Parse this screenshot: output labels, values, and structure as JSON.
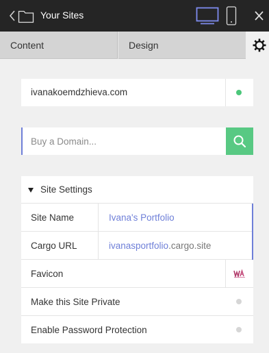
{
  "topbar": {
    "title": "Your Sites",
    "icons": [
      "chevron-left-icon",
      "folder-icon",
      "desktop-icon",
      "mobile-icon",
      "close-icon"
    ]
  },
  "tabs": {
    "content": "Content",
    "design": "Design",
    "settings_icon": "gear-icon"
  },
  "domain": {
    "value": "ivanakoemdzhieva.com",
    "status_color": "#4cc77a"
  },
  "buy_domain": {
    "placeholder": "Buy a Domain...",
    "button_color": "#58c983"
  },
  "site_settings": {
    "title": "Site Settings",
    "site_name_label": "Site Name",
    "site_name_value": "Ivana's Portfolio",
    "cargo_url_label": "Cargo URL",
    "cargo_url_value": "ivanasportfolio",
    "cargo_url_suffix": ".cargo.site",
    "favicon_label": "Favicon",
    "private_label": "Make this Site Private",
    "password_label": "Enable Password Protection"
  },
  "colors": {
    "accent": "#6e7fd8",
    "topbar": "#252525"
  }
}
